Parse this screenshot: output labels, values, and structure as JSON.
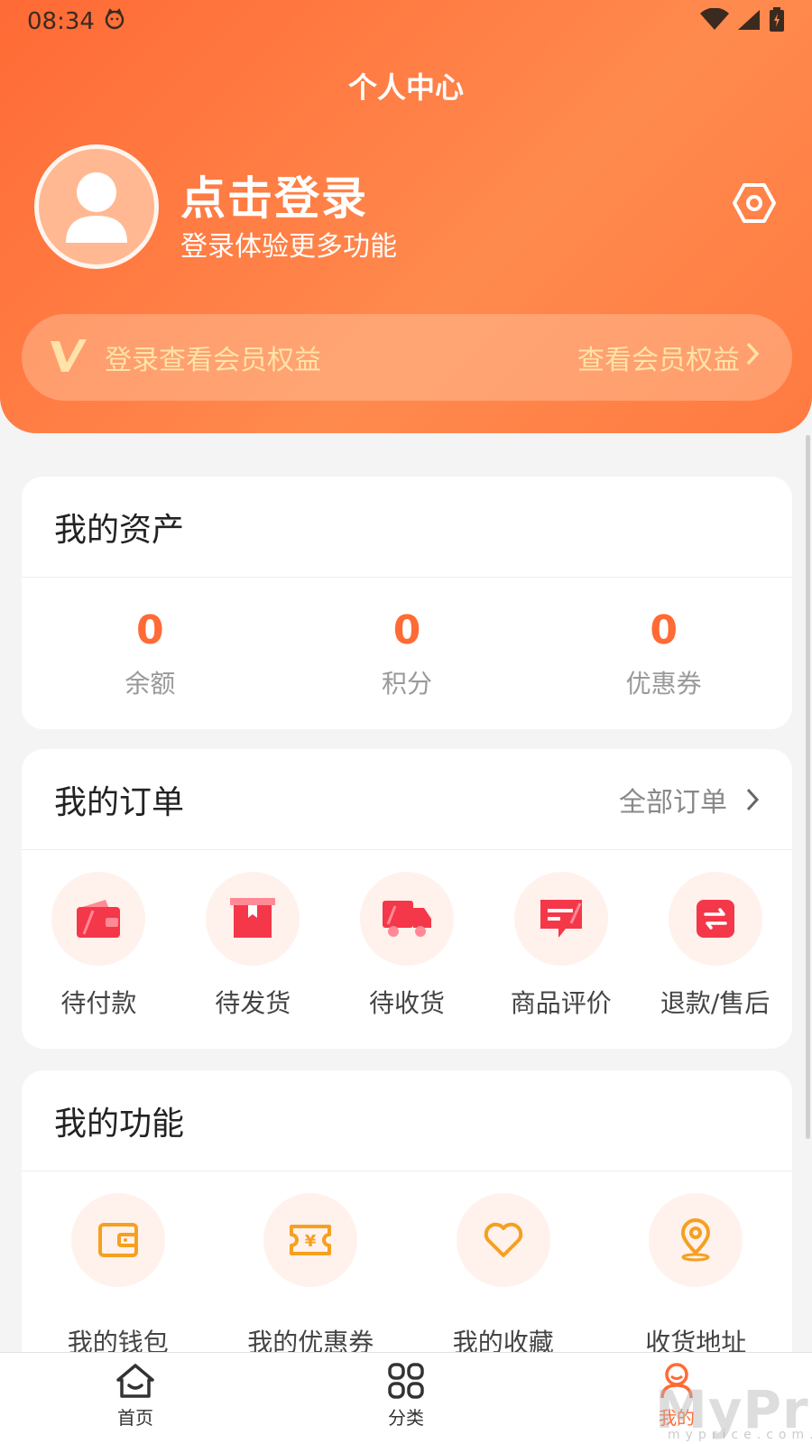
{
  "status": {
    "time": "08:34"
  },
  "header": {
    "title": "个人中心",
    "login_title": "点击登录",
    "login_subtitle": "登录体验更多功能"
  },
  "member": {
    "text": "登录查看会员权益",
    "link": "查看会员权益"
  },
  "assets": {
    "title": "我的资产",
    "items": [
      {
        "value": "0",
        "label": "余额"
      },
      {
        "value": "0",
        "label": "积分"
      },
      {
        "value": "0",
        "label": "优惠券"
      }
    ]
  },
  "orders": {
    "title": "我的订单",
    "all_link": "全部订单",
    "items": [
      {
        "label": "待付款",
        "icon": "wallet-icon"
      },
      {
        "label": "待发货",
        "icon": "package-icon"
      },
      {
        "label": "待收货",
        "icon": "truck-icon"
      },
      {
        "label": "商品评价",
        "icon": "comment-icon"
      },
      {
        "label": "退款/售后",
        "icon": "refund-icon"
      }
    ]
  },
  "functions": {
    "title": "我的功能",
    "items": [
      {
        "label": "我的钱包",
        "icon": "wallet-icon"
      },
      {
        "label": "我的优惠券",
        "icon": "coupon-icon"
      },
      {
        "label": "我的收藏",
        "icon": "heart-icon"
      },
      {
        "label": "收货地址",
        "icon": "location-icon"
      }
    ]
  },
  "nav": {
    "items": [
      {
        "label": "首页",
        "icon": "home-icon"
      },
      {
        "label": "分类",
        "icon": "grid-icon"
      },
      {
        "label": "我的",
        "icon": "user-icon",
        "active": true
      }
    ]
  },
  "watermark": {
    "text": "MyPrice",
    "sub": "myprice.com.cn"
  },
  "colors": {
    "accent": "#ff6a35",
    "gold": "#ffe3a8",
    "icon_red": "#f5374a",
    "icon_orange": "#f5a020"
  }
}
